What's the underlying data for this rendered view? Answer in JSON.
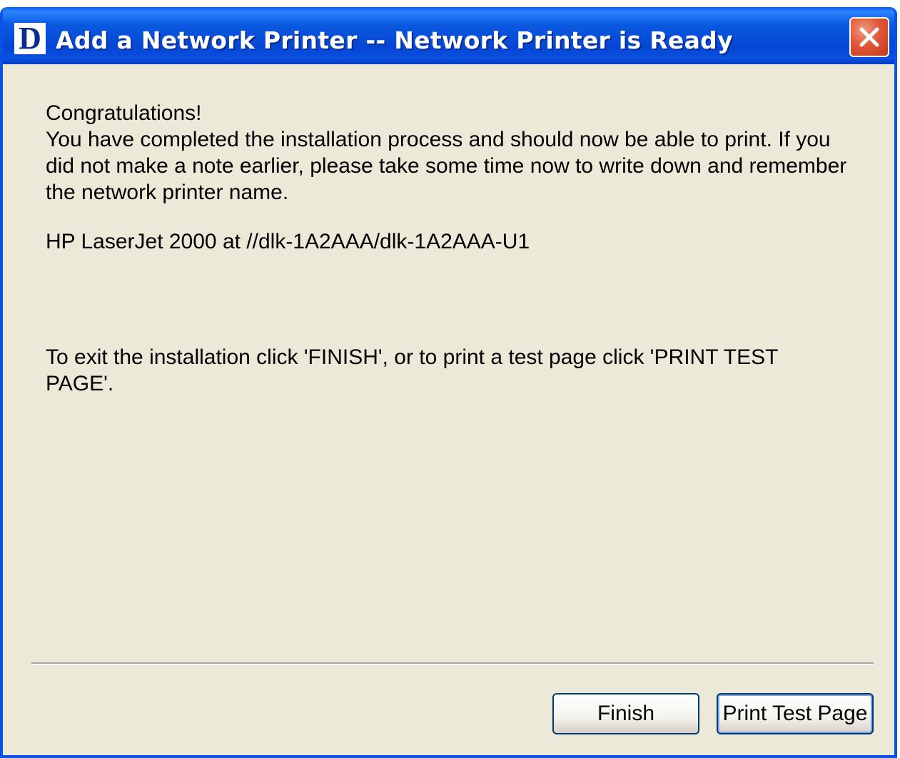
{
  "window": {
    "app_icon_letter": "D",
    "title": "Add a Network Printer -- Network Printer is Ready"
  },
  "body": {
    "heading": "Congratulations!",
    "paragraph": "You have completed the installation process and should now be able to print. If you did not make a note earlier, please take some time now to write down and remember the network printer name.",
    "printer_name": "HP LaserJet 2000 at //dlk-1A2AAA/dlk-1A2AAA-U1",
    "exit_instructions": "To exit the installation click 'FINISH', or to print a test page click 'PRINT TEST PAGE'."
  },
  "buttons": {
    "finish_label": "Finish",
    "print_test_page_label": "Print Test Page"
  },
  "colors": {
    "titlebar_blue": "#0a53e6",
    "dialog_background": "#ece9d8",
    "close_button_red": "#e0573a"
  },
  "icons": {
    "app_icon": "dlink-logo-icon",
    "close_icon": "close-icon"
  }
}
